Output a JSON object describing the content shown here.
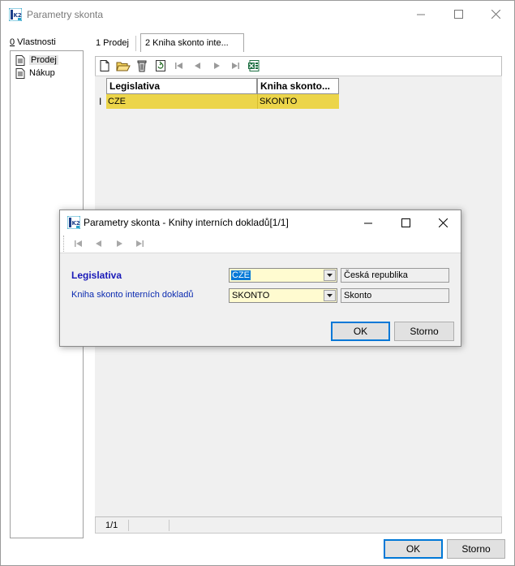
{
  "window": {
    "title": "Parametry skonta",
    "app_icon": "k2-logo-icon"
  },
  "left": {
    "props_hotkey": "0",
    "props_label": " Vlastnosti",
    "items": [
      {
        "label": "Prodej",
        "icon": "document-icon",
        "selected": true
      },
      {
        "label": "Nákup",
        "icon": "document-icon",
        "selected": false
      }
    ]
  },
  "tabs": [
    {
      "label": "1 Prodej"
    },
    {
      "label": "2 Kniha skonto inte..."
    }
  ],
  "toolbar": {
    "icons": [
      "new-document-icon",
      "open-folder-icon",
      "delete-icon",
      "refresh-icon",
      "first-record-icon",
      "prev-record-icon",
      "next-record-icon",
      "last-record-icon",
      "excel-export-icon"
    ]
  },
  "grid": {
    "columns": [
      "Legislativa",
      "Kniha skonto..."
    ],
    "rows": [
      [
        "CZE",
        "SKONTO"
      ]
    ],
    "row_indicator": "I"
  },
  "status": {
    "page": "1/1"
  },
  "buttons": {
    "ok": "OK",
    "storno": "Storno"
  },
  "dialog": {
    "title": "Parametry skonta - Knihy interních dokladů[1/1]",
    "fields": [
      {
        "label": "Legislativa",
        "value": "CZE",
        "description": "Česká republika"
      },
      {
        "label": "Kniha skonto interních dokladů",
        "value": "SKONTO",
        "description": "Skonto"
      }
    ],
    "ok": "OK",
    "storno": "Storno"
  },
  "colors": {
    "selected_row": "#ecd54a",
    "accent": "#0078d7",
    "label_blue": "#1a1ab8",
    "combo_bg": "#fffbd0"
  }
}
